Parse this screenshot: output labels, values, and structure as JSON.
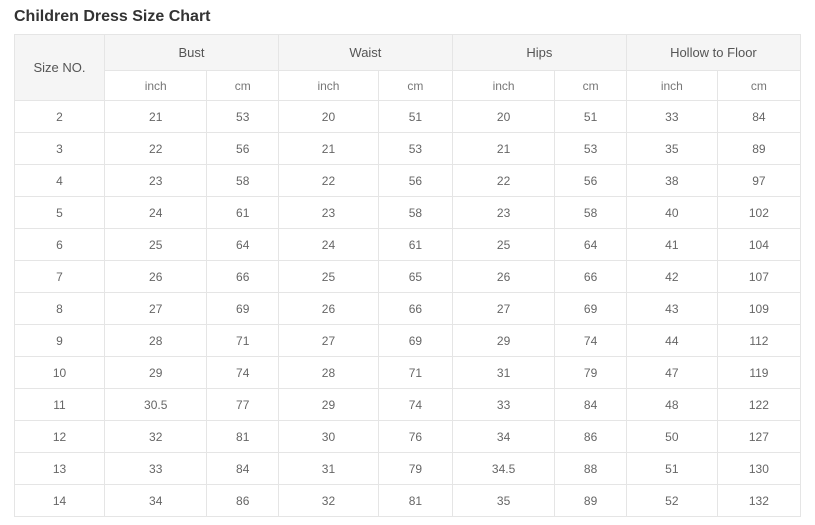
{
  "chart_data": {
    "type": "table",
    "title": "Children Dress Size Chart",
    "headers": {
      "size_no": "Size NO.",
      "groups": [
        {
          "label": "Bust",
          "units": [
            "inch",
            "cm"
          ]
        },
        {
          "label": "Waist",
          "units": [
            "inch",
            "cm"
          ]
        },
        {
          "label": "Hips",
          "units": [
            "inch",
            "cm"
          ]
        },
        {
          "label": "Hollow to Floor",
          "units": [
            "inch",
            "cm"
          ]
        }
      ]
    },
    "rows": [
      {
        "size": "2",
        "bust_in": "21",
        "bust_cm": "53",
        "waist_in": "20",
        "waist_cm": "51",
        "hips_in": "20",
        "hips_cm": "51",
        "htf_in": "33",
        "htf_cm": "84"
      },
      {
        "size": "3",
        "bust_in": "22",
        "bust_cm": "56",
        "waist_in": "21",
        "waist_cm": "53",
        "hips_in": "21",
        "hips_cm": "53",
        "htf_in": "35",
        "htf_cm": "89"
      },
      {
        "size": "4",
        "bust_in": "23",
        "bust_cm": "58",
        "waist_in": "22",
        "waist_cm": "56",
        "hips_in": "22",
        "hips_cm": "56",
        "htf_in": "38",
        "htf_cm": "97"
      },
      {
        "size": "5",
        "bust_in": "24",
        "bust_cm": "61",
        "waist_in": "23",
        "waist_cm": "58",
        "hips_in": "23",
        "hips_cm": "58",
        "htf_in": "40",
        "htf_cm": "102"
      },
      {
        "size": "6",
        "bust_in": "25",
        "bust_cm": "64",
        "waist_in": "24",
        "waist_cm": "61",
        "hips_in": "25",
        "hips_cm": "64",
        "htf_in": "41",
        "htf_cm": "104"
      },
      {
        "size": "7",
        "bust_in": "26",
        "bust_cm": "66",
        "waist_in": "25",
        "waist_cm": "65",
        "hips_in": "26",
        "hips_cm": "66",
        "htf_in": "42",
        "htf_cm": "107"
      },
      {
        "size": "8",
        "bust_in": "27",
        "bust_cm": "69",
        "waist_in": "26",
        "waist_cm": "66",
        "hips_in": "27",
        "hips_cm": "69",
        "htf_in": "43",
        "htf_cm": "109"
      },
      {
        "size": "9",
        "bust_in": "28",
        "bust_cm": "71",
        "waist_in": "27",
        "waist_cm": "69",
        "hips_in": "29",
        "hips_cm": "74",
        "htf_in": "44",
        "htf_cm": "112"
      },
      {
        "size": "10",
        "bust_in": "29",
        "bust_cm": "74",
        "waist_in": "28",
        "waist_cm": "71",
        "hips_in": "31",
        "hips_cm": "79",
        "htf_in": "47",
        "htf_cm": "119"
      },
      {
        "size": "11",
        "bust_in": "30.5",
        "bust_cm": "77",
        "waist_in": "29",
        "waist_cm": "74",
        "hips_in": "33",
        "hips_cm": "84",
        "htf_in": "48",
        "htf_cm": "122"
      },
      {
        "size": "12",
        "bust_in": "32",
        "bust_cm": "81",
        "waist_in": "30",
        "waist_cm": "76",
        "hips_in": "34",
        "hips_cm": "86",
        "htf_in": "50",
        "htf_cm": "127"
      },
      {
        "size": "13",
        "bust_in": "33",
        "bust_cm": "84",
        "waist_in": "31",
        "waist_cm": "79",
        "hips_in": "34.5",
        "hips_cm": "88",
        "htf_in": "51",
        "htf_cm": "130"
      },
      {
        "size": "14",
        "bust_in": "34",
        "bust_cm": "86",
        "waist_in": "32",
        "waist_cm": "81",
        "hips_in": "35",
        "hips_cm": "89",
        "htf_in": "52",
        "htf_cm": "132"
      }
    ]
  }
}
